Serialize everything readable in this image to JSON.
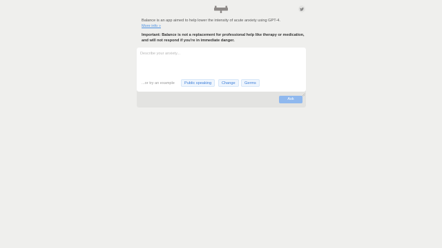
{
  "header": {
    "logo_icon": "balance-scale-logo",
    "social_icon": "twitter-icon"
  },
  "intro": {
    "text": "Balance is an app aimed to help lower the intensity of acute anxiety using GPT-4.",
    "more_info_link": "More info »"
  },
  "disclaimer": {
    "text": "Important: Balance is not a replacement for professional help like therapy or medication, and will not respond if you're in immediate danger."
  },
  "input": {
    "placeholder": "Describe your anxiety...",
    "value": ""
  },
  "examples": {
    "label": "...or try an example",
    "chips": [
      "Public speaking",
      "Change",
      "Germs"
    ]
  },
  "actions": {
    "ask_label": "Ask"
  },
  "colors": {
    "background": "#efefed",
    "accent": "#4a90e2",
    "button": "#8fb8ee"
  }
}
